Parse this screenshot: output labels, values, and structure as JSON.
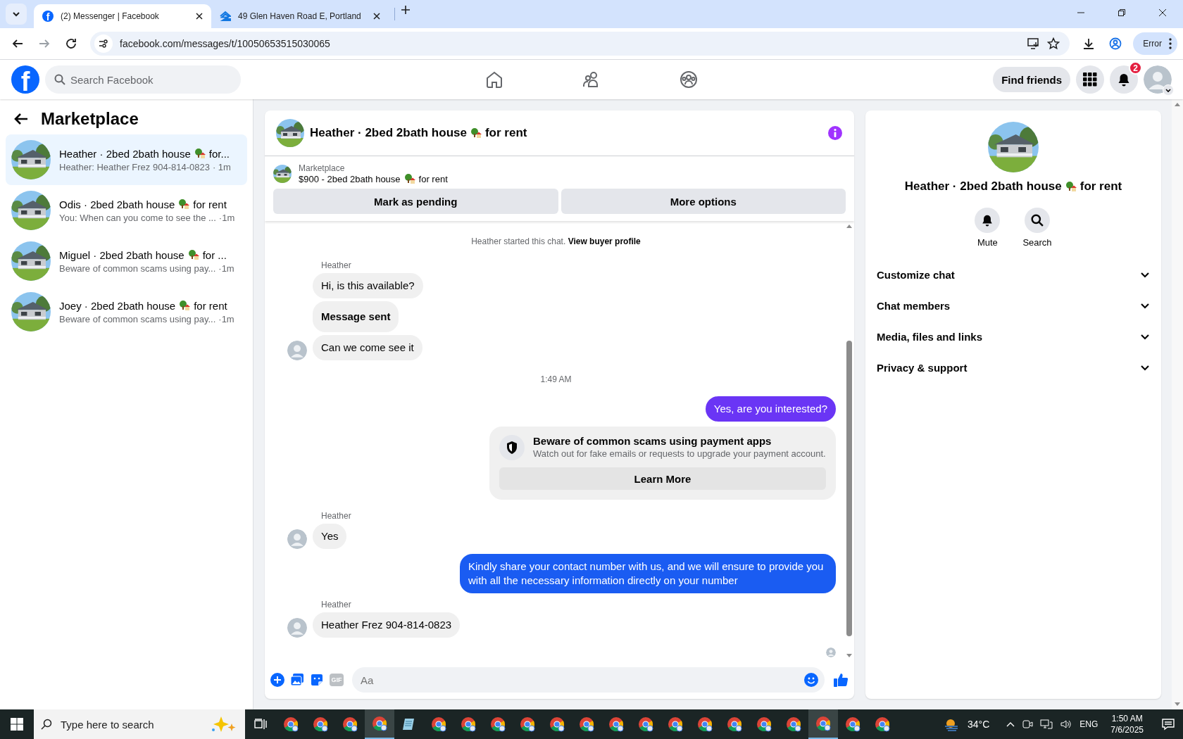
{
  "browser": {
    "tabs": [
      {
        "kind": "facebook",
        "favicon": "f",
        "title": "(2) Messenger | Facebook",
        "selected": true
      },
      {
        "kind": "house",
        "title": "49 Glen Haven Road E, Portland",
        "selected": false
      }
    ],
    "url": "facebook.com/messages/t/10050653515030065",
    "profile_label": "Error"
  },
  "header": {
    "logo": "f",
    "search_placeholder": "Search Facebook",
    "find_friends": "Find friends",
    "notification_count": "2"
  },
  "sidebar": {
    "title": "Marketplace",
    "conversations": [
      {
        "title": "Heather · 2bed 2bath house",
        "suffix": "for...",
        "preview": "Heather: Heather Frez 904-814-0823",
        "time": "· 1m",
        "selected": true
      },
      {
        "title": "Odis · 2bed 2bath house",
        "suffix": "for rent",
        "preview": "You: When can you come to see the ...",
        "time": "·1m",
        "selected": false
      },
      {
        "title": "Miguel · 2bed 2bath house",
        "suffix": "for ...",
        "preview": "Beware of common scams using pay...",
        "time": "·1m",
        "selected": false
      },
      {
        "title": "Joey · 2bed 2bath house",
        "suffix": "for rent",
        "preview": "Beware of common scams using pay...",
        "time": "·1m",
        "selected": false
      }
    ]
  },
  "chat": {
    "title": "Heather · 2bed 2bath house",
    "title_suffix": "for rent",
    "listing": {
      "label": "Marketplace",
      "text": "$900 - 2bed 2bath house",
      "suffix": "for rent"
    },
    "buttons": [
      "Mark as pending",
      "More options"
    ],
    "messages": [
      {
        "kind": "system",
        "text": "Heather started this chat.",
        "link": "View buyer profile"
      },
      {
        "kind": "sender",
        "text": "Heather"
      },
      {
        "kind": "incoming",
        "text": "Hi, is this available?",
        "avatar": false,
        "bold": false
      },
      {
        "kind": "incoming",
        "text": "Message sent",
        "avatar": false,
        "bold": true
      },
      {
        "kind": "incoming",
        "text": "Can we come see it",
        "avatar": true,
        "bold": false
      },
      {
        "kind": "time",
        "text": "1:49 AM"
      },
      {
        "kind": "outgoing",
        "text": "Yes, are you interested?",
        "color": "#6a35f5"
      },
      {
        "kind": "notice",
        "title": "Beware of common scams using payment apps",
        "body": "Watch out for fake emails or requests to upgrade your payment account.",
        "button": "Learn More"
      },
      {
        "kind": "sender",
        "text": "Heather"
      },
      {
        "kind": "incoming",
        "text": "Yes",
        "avatar": true,
        "bold": false
      },
      {
        "kind": "outgoing",
        "text": "Kindly share your contact number with us, and we will ensure to provide you with all the necessary information directly on your number",
        "color": "#1a5cf2"
      },
      {
        "kind": "sender",
        "text": "Heather"
      },
      {
        "kind": "incoming",
        "text": "Heather Frez 904-814-0823",
        "avatar": true,
        "bold": false
      },
      {
        "kind": "seen"
      }
    ],
    "composer": {
      "gif_label": "GIF",
      "placeholder": "Aa"
    }
  },
  "details": {
    "title": "Heather · 2bed 2bath house",
    "title_suffix": "for rent",
    "actions": [
      {
        "kind": "mute",
        "label": "Mute"
      },
      {
        "kind": "search",
        "label": "Search"
      }
    ],
    "sections": [
      {
        "label": "Customize chat",
        "expanded": false
      },
      {
        "label": "Chat members",
        "expanded": false
      },
      {
        "label": "Media, files and links",
        "expanded": false
      },
      {
        "label": "Privacy & support",
        "expanded": false
      }
    ]
  },
  "taskbar": {
    "search_placeholder": "Type here to search",
    "apps": [
      {
        "kind": "chrome",
        "active": false
      },
      {
        "kind": "chrome",
        "active": false
      },
      {
        "kind": "chrome",
        "active": false
      },
      {
        "kind": "chrome",
        "active": true
      },
      {
        "kind": "notepad",
        "active": false
      },
      {
        "kind": "chrome",
        "active": false
      },
      {
        "kind": "chrome",
        "active": false
      },
      {
        "kind": "chrome",
        "active": false
      },
      {
        "kind": "chrome",
        "active": false
      },
      {
        "kind": "chrome",
        "active": false
      },
      {
        "kind": "chrome",
        "active": false
      },
      {
        "kind": "chrome",
        "active": false
      },
      {
        "kind": "chrome",
        "active": false
      },
      {
        "kind": "chrome",
        "active": false
      },
      {
        "kind": "chrome",
        "active": false
      },
      {
        "kind": "chrome",
        "active": false
      },
      {
        "kind": "chrome",
        "active": false
      },
      {
        "kind": "chrome",
        "active": false
      },
      {
        "kind": "chrome",
        "active": true
      },
      {
        "kind": "chrome",
        "active": false
      },
      {
        "kind": "chrome",
        "active": false
      }
    ],
    "temperature": "34°C",
    "language": "ENG",
    "time": "1:50 AM",
    "date": "7/6/2025"
  }
}
